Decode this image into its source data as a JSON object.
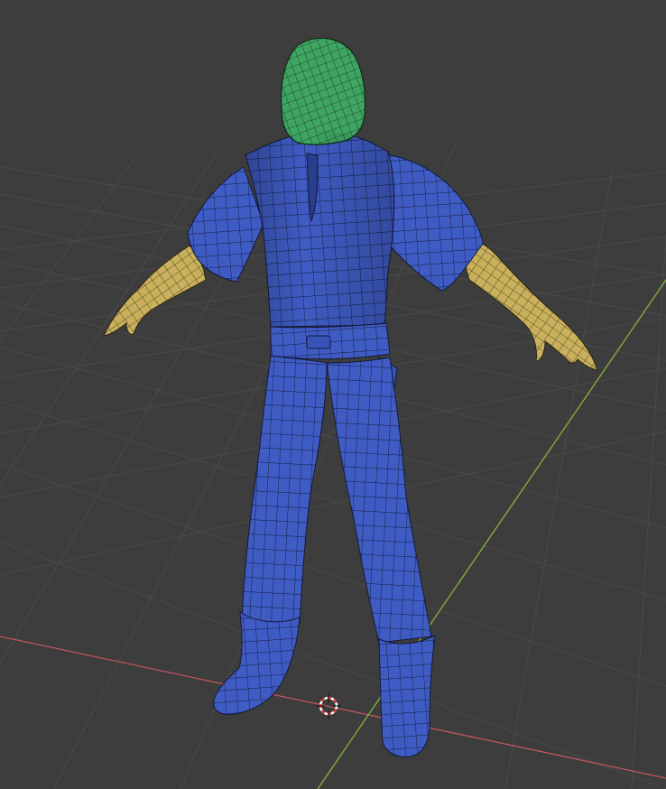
{
  "viewport": {
    "background": "#3d3d3d",
    "grid_color": "#4a4a4a",
    "x_axis_color": "#c0555f",
    "y_axis_color": "#86b341",
    "show_grid": true
  },
  "model": {
    "body_color": "#3f5cc4",
    "head_color": "#3fa563",
    "hands_color": "#c9b05c",
    "wire_color": "#141a38",
    "hood_wire_color": "#123019",
    "glove_wire_color": "#3d3314",
    "mesh_display": "wireframe-overlay",
    "pose": "T-pose"
  },
  "cursor": {
    "icon": "3d-cursor-icon",
    "ring_colors": [
      "#e04040",
      "#ffffff"
    ]
  }
}
